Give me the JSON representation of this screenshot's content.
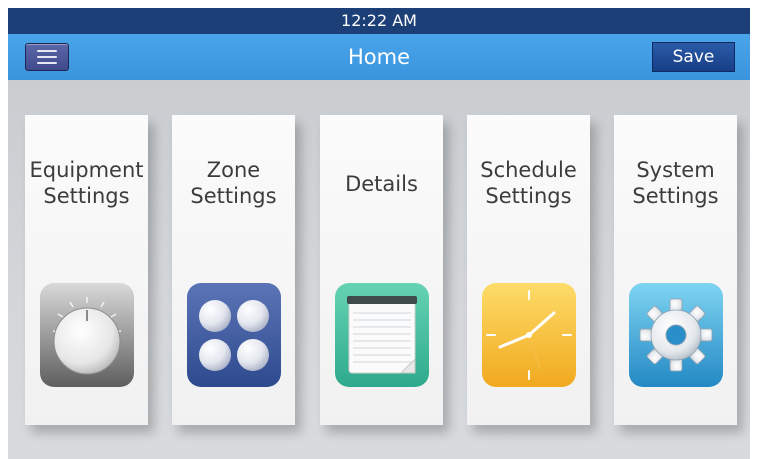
{
  "status_bar": {
    "time": "12:22 AM"
  },
  "header": {
    "title": "Home",
    "save_label": "Save",
    "menu_icon": "hamburger-menu-icon"
  },
  "cards": [
    {
      "label": "Equipment\nSettings",
      "icon": "dial-knob-icon"
    },
    {
      "label": "Zone\nSettings",
      "icon": "zone-buttons-icon"
    },
    {
      "label": "Details",
      "icon": "notepad-icon"
    },
    {
      "label": "Schedule\nSettings",
      "icon": "clock-icon"
    },
    {
      "label": "System\nSettings",
      "icon": "gear-icon"
    }
  ],
  "colors": {
    "status_bar": "#1d3f78",
    "header": "#3b95de",
    "save_button": "#1f4b94",
    "menu_button": "#4a559a",
    "background": "#cfd3d6",
    "card": "#f5f5f5"
  }
}
